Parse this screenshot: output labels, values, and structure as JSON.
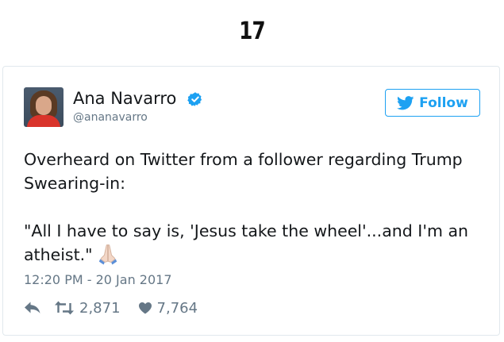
{
  "rank": "17",
  "tweet": {
    "author_name": "Ana Navarro",
    "handle": "@ananavarro",
    "follow_label": "Follow",
    "text": "Overheard on Twitter from a follower regarding Trump Swearing-in:\n\n\"All I have to say is, 'Jesus take the wheel'...and I'm an atheist.\"",
    "timestamp": "12:20 PM - 20 Jan 2017",
    "retweets": "2,871",
    "likes": "7,764"
  },
  "colors": {
    "accent": "#1da1f2",
    "muted": "#657786",
    "text": "#14171a"
  },
  "icons": [
    "verified-badge-icon",
    "twitter-bird-icon",
    "praying-hands-emoji",
    "reply-icon",
    "retweet-icon",
    "heart-icon"
  ]
}
